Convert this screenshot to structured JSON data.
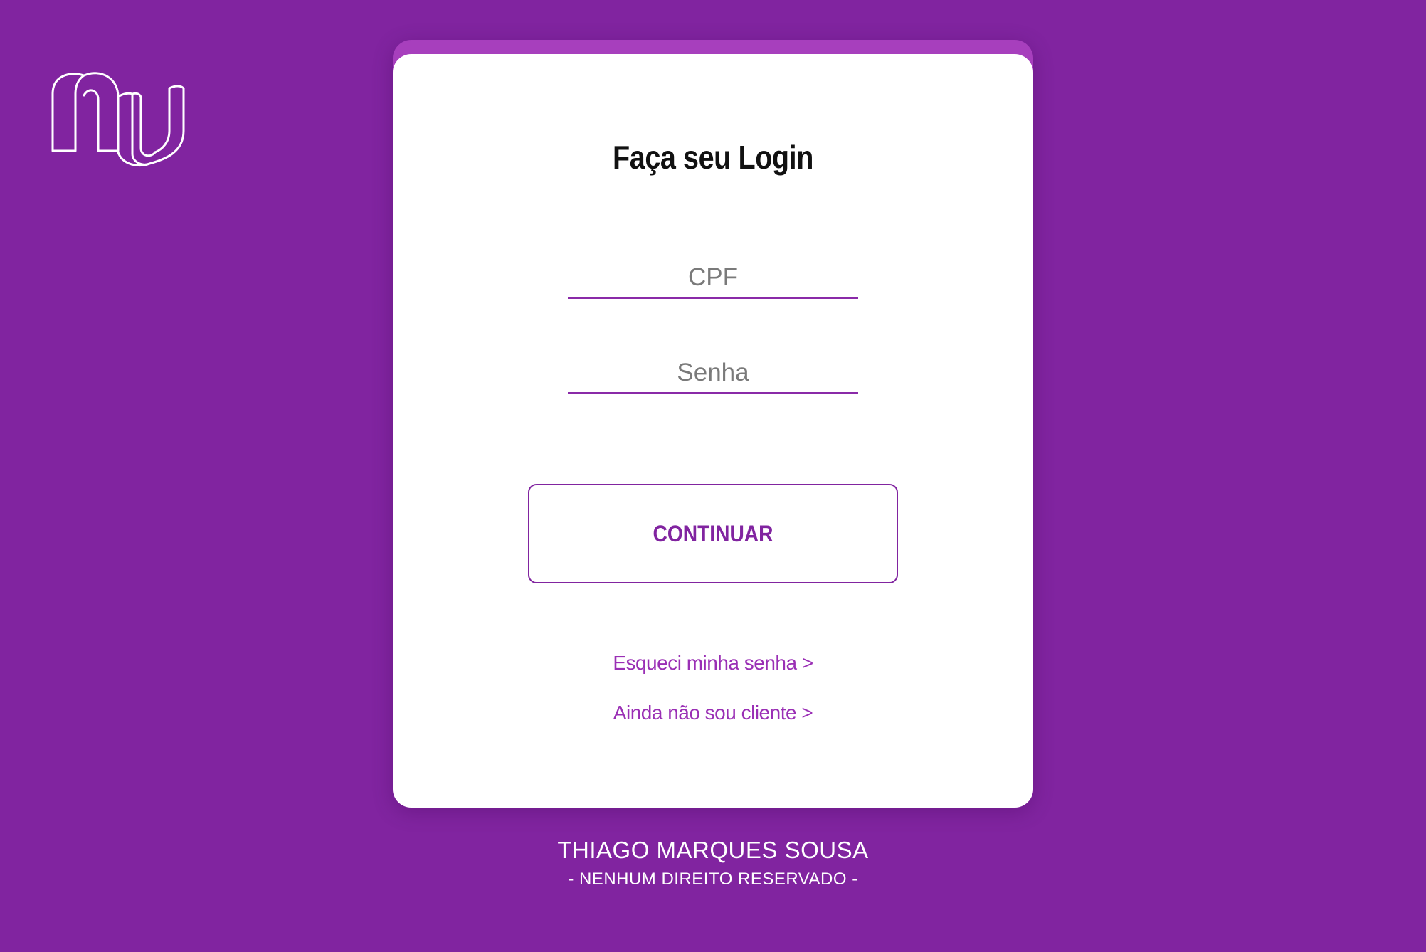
{
  "brand": {
    "logo_icon": "nu-logo-icon",
    "background_color": "#8124a0",
    "accent_color": "#a73fbd"
  },
  "login": {
    "title": "Faça seu Login",
    "cpf_placeholder": "CPF",
    "cpf_value": "",
    "password_placeholder": "Senha",
    "password_value": "",
    "continue_label": "CONTINUAR",
    "forgot_password_label": "Esqueci minha senha >",
    "not_client_label": "Ainda não sou cliente >"
  },
  "footer": {
    "author": "THIAGO MARQUES SOUSA",
    "rights": "- NENHUM DIREITO RESERVADO -"
  }
}
